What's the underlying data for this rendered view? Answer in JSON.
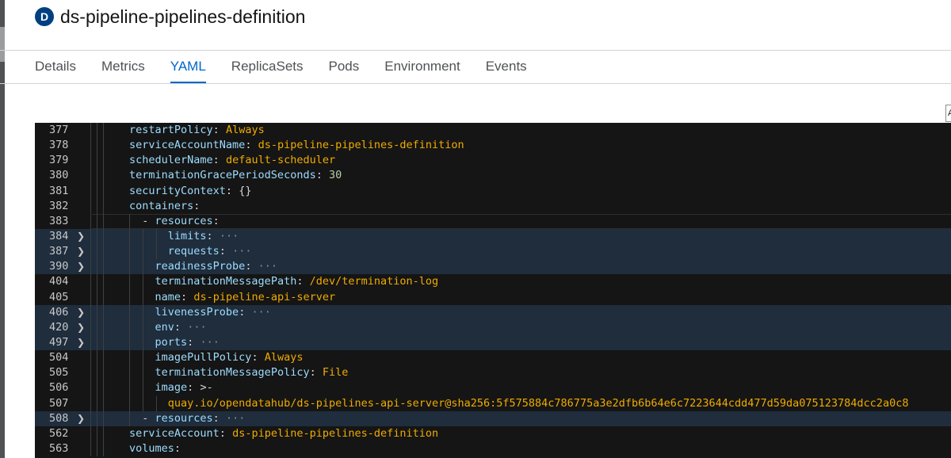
{
  "header": {
    "badge": "D",
    "title": "ds-pipeline-pipelines-definition"
  },
  "tabs": [
    {
      "label": "Details",
      "active": false
    },
    {
      "label": "Metrics",
      "active": false
    },
    {
      "label": "YAML",
      "active": true
    },
    {
      "label": "ReplicaSets",
      "active": false
    },
    {
      "label": "Pods",
      "active": false
    },
    {
      "label": "Environment",
      "active": false
    },
    {
      "label": "Events",
      "active": false
    }
  ],
  "corner_button": {
    "label": "A"
  },
  "editor": {
    "lines": [
      {
        "num": "377",
        "indent": 0,
        "dash": false,
        "key": "restartPolicy",
        "value": "Always",
        "vtype": "str",
        "fold": false,
        "folded": false,
        "hl": false
      },
      {
        "num": "378",
        "indent": 0,
        "dash": false,
        "key": "serviceAccountName",
        "value": "ds-pipeline-pipelines-definition",
        "vtype": "str",
        "fold": false,
        "folded": false,
        "hl": false
      },
      {
        "num": "379",
        "indent": 0,
        "dash": false,
        "key": "schedulerName",
        "value": "default-scheduler",
        "vtype": "str",
        "fold": false,
        "folded": false,
        "hl": false
      },
      {
        "num": "380",
        "indent": 0,
        "dash": false,
        "key": "terminationGracePeriodSeconds",
        "value": "30",
        "vtype": "num",
        "fold": false,
        "folded": false,
        "hl": false
      },
      {
        "num": "381",
        "indent": 0,
        "dash": false,
        "key": "securityContext",
        "value": "{}",
        "vtype": "punct",
        "fold": false,
        "folded": false,
        "hl": false
      },
      {
        "num": "382",
        "indent": 0,
        "dash": false,
        "key": "containers",
        "value": "",
        "vtype": "none",
        "fold": false,
        "folded": false,
        "hl": false
      },
      {
        "num": "383",
        "indent": 1,
        "dash": true,
        "key": "resources",
        "value": "",
        "vtype": "none",
        "fold": false,
        "folded": false,
        "hl": false,
        "cursor": true
      },
      {
        "num": "384",
        "indent": 3,
        "dash": false,
        "key": "limits",
        "value": "···",
        "vtype": "fold",
        "fold": true,
        "folded": true,
        "hl": true
      },
      {
        "num": "387",
        "indent": 3,
        "dash": false,
        "key": "requests",
        "value": "···",
        "vtype": "fold",
        "fold": true,
        "folded": true,
        "hl": true
      },
      {
        "num": "390",
        "indent": 2,
        "dash": false,
        "key": "readinessProbe",
        "value": "···",
        "vtype": "fold",
        "fold": true,
        "folded": true,
        "hl": true
      },
      {
        "num": "404",
        "indent": 2,
        "dash": false,
        "key": "terminationMessagePath",
        "value": "/dev/termination-log",
        "vtype": "str",
        "fold": false,
        "folded": false,
        "hl": false
      },
      {
        "num": "405",
        "indent": 2,
        "dash": false,
        "key": "name",
        "value": "ds-pipeline-api-server",
        "vtype": "str",
        "fold": false,
        "folded": false,
        "hl": false
      },
      {
        "num": "406",
        "indent": 2,
        "dash": false,
        "key": "livenessProbe",
        "value": "···",
        "vtype": "fold",
        "fold": true,
        "folded": true,
        "hl": true
      },
      {
        "num": "420",
        "indent": 2,
        "dash": false,
        "key": "env",
        "value": "···",
        "vtype": "fold",
        "fold": true,
        "folded": true,
        "hl": true
      },
      {
        "num": "497",
        "indent": 2,
        "dash": false,
        "key": "ports",
        "value": "···",
        "vtype": "fold",
        "fold": true,
        "folded": true,
        "hl": true
      },
      {
        "num": "504",
        "indent": 2,
        "dash": false,
        "key": "imagePullPolicy",
        "value": "Always",
        "vtype": "str",
        "fold": false,
        "folded": false,
        "hl": false
      },
      {
        "num": "505",
        "indent": 2,
        "dash": false,
        "key": "terminationMessagePolicy",
        "value": "File",
        "vtype": "str",
        "fold": false,
        "folded": false,
        "hl": false
      },
      {
        "num": "506",
        "indent": 2,
        "dash": false,
        "key": "image",
        "value": ">-",
        "vtype": "punct",
        "fold": false,
        "folded": false,
        "hl": false
      },
      {
        "num": "507",
        "indent": 3,
        "dash": false,
        "key": "",
        "value": "quay.io/opendatahub/ds-pipelines-api-server@sha256:5f575884c786775a3e2dfb6b64e6c7223644cdd477d59da075123784dcc2a0c8",
        "vtype": "str",
        "fold": false,
        "folded": false,
        "hl": false
      },
      {
        "num": "508",
        "indent": 1,
        "dash": true,
        "key": "resources",
        "value": "···",
        "vtype": "fold",
        "fold": true,
        "folded": true,
        "hl": true
      },
      {
        "num": "562",
        "indent": 0,
        "dash": false,
        "key": "serviceAccount",
        "value": "ds-pipeline-pipelines-definition",
        "vtype": "str",
        "fold": false,
        "folded": false,
        "hl": false
      },
      {
        "num": "563",
        "indent": 0,
        "dash": false,
        "key": "volumes",
        "value": "",
        "vtype": "none",
        "fold": false,
        "folded": false,
        "hl": false
      }
    ]
  }
}
